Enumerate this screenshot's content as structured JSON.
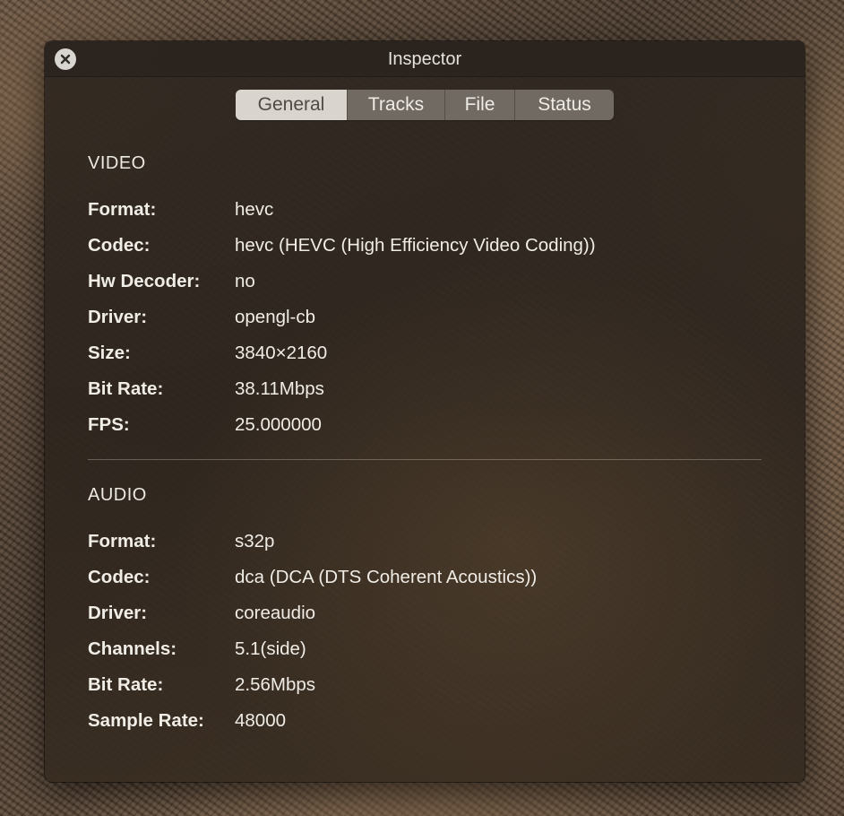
{
  "window": {
    "title": "Inspector"
  },
  "tabs": [
    {
      "label": "General",
      "active": true
    },
    {
      "label": "Tracks",
      "active": false
    },
    {
      "label": "File",
      "active": false
    },
    {
      "label": "Status",
      "active": false
    }
  ],
  "video": {
    "heading": "VIDEO",
    "rows": [
      {
        "label": "Format:",
        "value": "hevc"
      },
      {
        "label": "Codec:",
        "value": "hevc (HEVC (High Efficiency Video Coding))"
      },
      {
        "label": "Hw Decoder:",
        "value": "no"
      },
      {
        "label": "Driver:",
        "value": "opengl-cb"
      },
      {
        "label": "Size:",
        "value": "3840×2160"
      },
      {
        "label": "Bit Rate:",
        "value": "38.11Mbps"
      },
      {
        "label": "FPS:",
        "value": "25.000000"
      }
    ]
  },
  "audio": {
    "heading": "AUDIO",
    "rows": [
      {
        "label": "Format:",
        "value": "s32p"
      },
      {
        "label": "Codec:",
        "value": "dca (DCA (DTS Coherent Acoustics))"
      },
      {
        "label": "Driver:",
        "value": "coreaudio"
      },
      {
        "label": "Channels:",
        "value": "5.1(side)"
      },
      {
        "label": "Bit Rate:",
        "value": "2.56Mbps"
      },
      {
        "label": "Sample Rate:",
        "value": "48000"
      }
    ]
  },
  "icons": {
    "close": "close-icon"
  }
}
